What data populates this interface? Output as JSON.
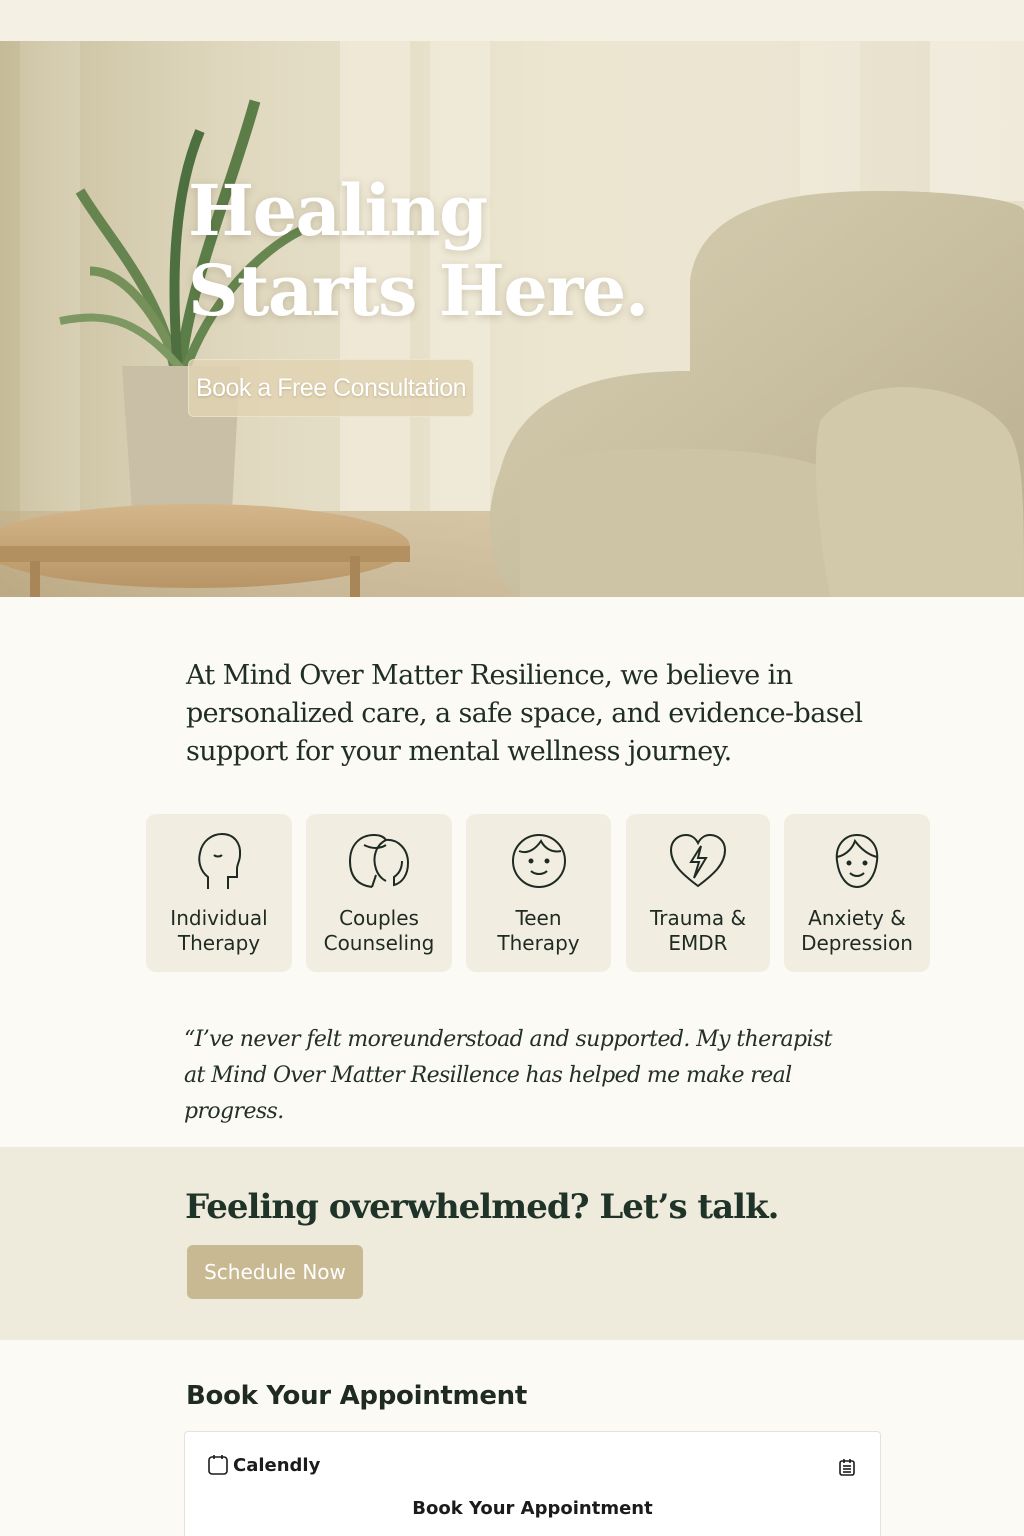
{
  "hero": {
    "title_line1": "Healing",
    "title_line2": "Starts Here.",
    "cta_label": "Book a Free Consultation"
  },
  "intro": {
    "text": "At Mind Over Matter Resilience, we believe in personalized care, a safe space, and evidence-basel support for your mental wellness journey."
  },
  "services": [
    {
      "label": "Individual\nTherapy",
      "icon": "head-profile-icon"
    },
    {
      "label": "Couples\nCounseling",
      "icon": "couple-faces-icon"
    },
    {
      "label": "Teen\nTherapy",
      "icon": "smiling-face-icon"
    },
    {
      "label": "Trauma &\nEMDR",
      "icon": "heart-lightning-icon"
    },
    {
      "label": "Anxiety &\nDepression",
      "icon": "person-face-icon"
    }
  ],
  "testimonial": {
    "text": "“I’ve never felt moreunderstoad and supported. My therapist at Mind Over Matter Resillence has helped me make real progress."
  },
  "cta": {
    "title": "Feeling overwhelmed? Let’s talk.",
    "button_label": "Schedule Now"
  },
  "booking": {
    "heading": "Book Your Appointment",
    "widget_brand": "Calendly",
    "widget_title": "Book Your Appointment"
  },
  "colors": {
    "accent_button": "#c9b993",
    "text_dark": "#1f2e25",
    "card_bg": "#f1eee1",
    "page_bg": "#fcfaf4"
  }
}
